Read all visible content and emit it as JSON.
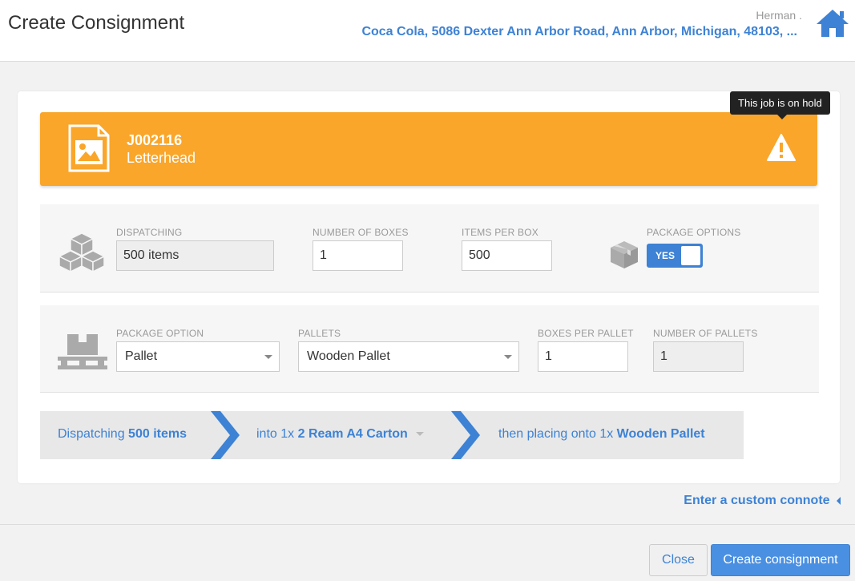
{
  "header": {
    "title": "Create Consignment",
    "user_name": "Herman .",
    "customer_address": "Coca Cola, 5086 Dexter Ann Arbor Road, Ann Arbor, Michigan, 48103, ...",
    "home_icon": "home-icon"
  },
  "job": {
    "number": "J002116",
    "name": "Letterhead",
    "image_icon": "image-icon",
    "status_icon": "warning-icon",
    "tooltip": "This job is on hold",
    "banner_color": "#f9a62b"
  },
  "dispatch_section": {
    "icon": "boxes-icon",
    "dispatching_label": "DISPATCHING",
    "dispatching_value": "500 items",
    "number_of_boxes_label": "NUMBER OF BOXES",
    "number_of_boxes_value": "1",
    "items_per_box_label": "ITEMS PER BOX",
    "items_per_box_value": "500",
    "package_options_label": "PACKAGE OPTIONS",
    "package_icon": "package-icon",
    "package_options_toggle": "YES"
  },
  "pallet_section": {
    "icon": "pallet-icon",
    "package_option_label": "PACKAGE OPTION",
    "package_option_value": "Pallet",
    "pallets_label": "PALLETS",
    "pallets_value": "Wooden Pallet",
    "boxes_per_pallet_label": "BOXES PER PALLET",
    "boxes_per_pallet_value": "1",
    "number_of_pallets_label": "NUMBER OF PALLETS",
    "number_of_pallets_value": "1"
  },
  "summary": {
    "step1_prefix": "Dispatching ",
    "step1_value": "500 items",
    "step2_prefix": "into 1x ",
    "step2_value": "2 Ream A4 Carton",
    "step3_prefix": "then placing onto 1x ",
    "step3_value": "Wooden Pallet"
  },
  "custom_connote_link": "Enter a custom connote",
  "footer": {
    "close_label": "Close",
    "create_label": "Create consignment"
  },
  "colors": {
    "accent": "#3d82d4",
    "primary_button": "#4a90e2",
    "on_hold": "#f9a62b"
  }
}
